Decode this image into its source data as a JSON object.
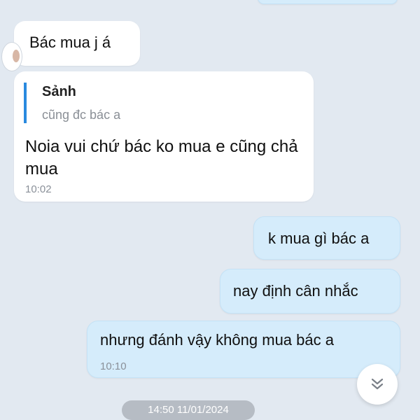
{
  "messages": [
    {
      "direction": "in",
      "text": "Bác mua j á"
    },
    {
      "direction": "in",
      "reply": {
        "author": "Sảnh",
        "text": "cũng đc bác a"
      },
      "text": "Noia vui chứ bác ko mua e cũng chả mua",
      "time": "10:02"
    },
    {
      "direction": "out",
      "text": "k mua gì bác a"
    },
    {
      "direction": "out",
      "text": "nay định cân nhắc"
    },
    {
      "direction": "out",
      "text": "nhưng đánh vậy không mua bác a",
      "time": "10:10"
    }
  ],
  "date_separator": "14:50 11/01/2024",
  "icons": {
    "scroll": "chevron-double-down-icon"
  },
  "colors": {
    "chat_background": "#e2e9f1",
    "incoming_bubble": "#ffffff",
    "outgoing_bubble": "#d5ecfb",
    "reply_accent": "#2a8adf"
  }
}
